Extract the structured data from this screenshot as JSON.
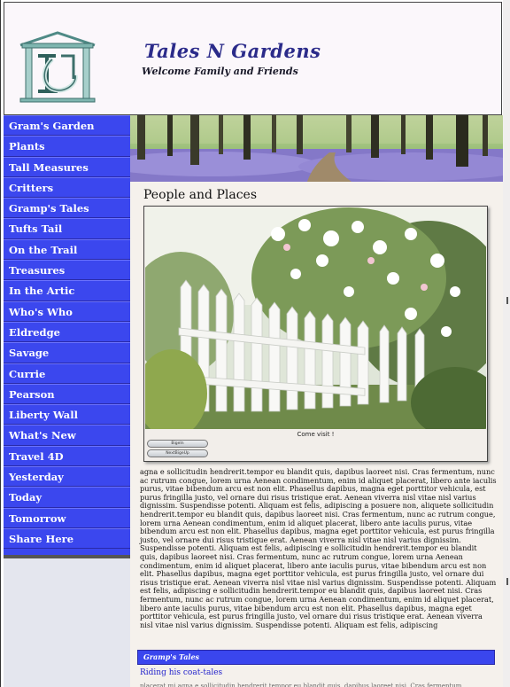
{
  "header": {
    "site_title": "Tales N Gardens",
    "site_subtitle": "Welcome Family and Friends"
  },
  "sidebar": {
    "items": [
      {
        "label": "Gram's Garden"
      },
      {
        "label": "Plants"
      },
      {
        "label": "Tall Measures"
      },
      {
        "label": "Critters"
      },
      {
        "label": "Gramp's Tales"
      },
      {
        "label": "Tufts Tail"
      },
      {
        "label": "On the Trail"
      },
      {
        "label": "Treasures"
      },
      {
        "label": "In the Artic"
      },
      {
        "label": "Who's Who"
      },
      {
        "label": "Eldredge"
      },
      {
        "label": "Savage"
      },
      {
        "label": "Currie"
      },
      {
        "label": "Pearson"
      },
      {
        "label": "Liberty Wall"
      },
      {
        "label": "What's New"
      },
      {
        "label": "Travel 4D"
      },
      {
        "label": "Yesterday"
      },
      {
        "label": "Today"
      },
      {
        "label": "Tomorrow"
      },
      {
        "label": "Share Here"
      }
    ]
  },
  "main": {
    "heading": "People and Places",
    "slideshow": {
      "caption": "Come visit !",
      "button_1": "BigeIn",
      "button_2": "NextBigeUp"
    },
    "body_text": "agna e sollicitudin hendrerit.tempor eu blandit quis, dapibus laoreet nisi. Cras fermentum, nunc ac rutrum congue, lorem urna Aenean condimentum, enim id aliquet placerat, libero ante iaculis purus, vitae bibendum arcu est non elit. Phasellus dapibus, magna eget porttitor vehicula, est purus fringilla justo, vel ornare dui risus tristique erat. Aenean viverra nisl vitae nisl varius dignissim. Suspendisse potenti. Aliquam est felis, adipiscing a posuere non, aliquete sollicitudin hendrerit.tempor eu blandit quis, dapibus laoreet nisi. Cras fermentum, nunc ac rutrum congue, lorem urna Aenean condimentum, enim id aliquet placerat, libero ante iaculis purus, vitae bibendum arcu est non elit. Phasellus dapibus, magna eget porttitor vehicula, est purus fringilla justo, vel ornare dui risus tristique erat. Aenean viverra nisl vitae nisl varius dignissim. Suspendisse potenti. Aliquam est felis, adipiscing e sollicitudin hendrerit.tempor eu blandit quis, dapibus laoreet nisi. Cras fermentum, nunc ac rutrum congue, lorem urna Aenean condimentum, enim id aliquet placerat, libero ante iaculis purus, vitae bibendum arcu est non elit. Phasellus dapibus, magna eget porttitor vehicula, est purus fringilla justo, vel ornare dui risus tristique erat. Aenean viverra nisl vitae nisl varius dignissim. Suspendisse potenti. Aliquam est felis, adipiscing e sollicitudin hendrerit.tempor eu blandit quis, dapibus laoreet nisi. Cras fermentum, nunc ac rutrum congue, lorem urna Aenean condimentum, enim id aliquet placerat, libero ante iaculis purus, vitae bibendum arcu est non elit. Phasellus dapibus, magna eget porttitor vehicula, est purus fringilla justo, vel ornare dui risus tristique erat. Aenean viverra nisl vitae nisl varius dignissim. Suspendisse potenti. Aliquam est felis, adipiscing",
    "section": {
      "title": "Gramp's Tales",
      "link": "Riding his coat-tales",
      "cut_text": "placerat mi agna e sollicitudin hendrerit.tempor eu blandit quis, dapibus laoreet nisi. Cras fermentum, nunc ac"
    }
  },
  "colors": {
    "nav_blue": "#3b47ee",
    "title_purple": "#2b2b8a",
    "content_bg": "#f5f1ec",
    "link_blue": "#2222cc"
  },
  "icons": {
    "logo": "house-monogram-logo"
  }
}
